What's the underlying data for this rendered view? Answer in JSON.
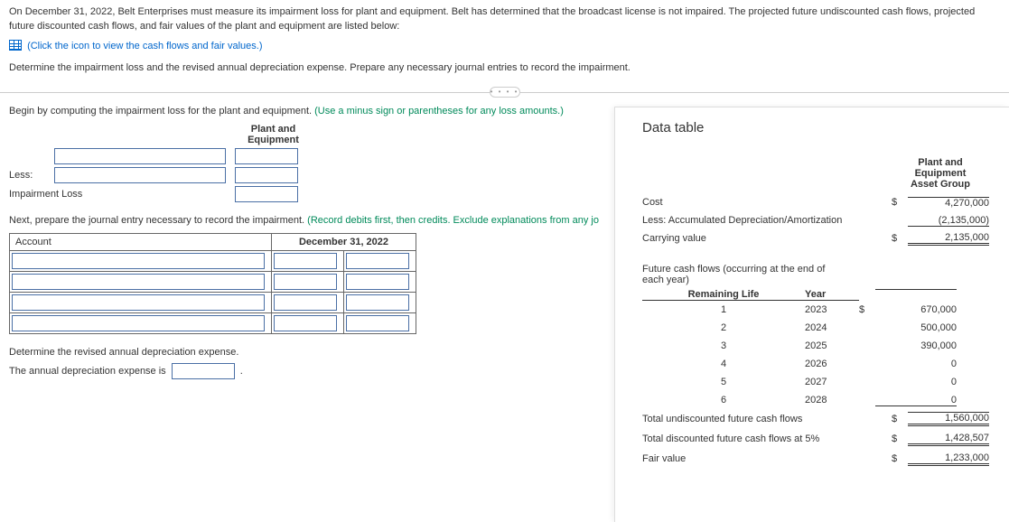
{
  "problem": {
    "p1": "On December 31, 2022, Belt Enterprises must measure its impairment loss for plant and equipment. Belt has determined that the broadcast license is not impaired. The projected future undiscounted cash flows, projected future discounted cash flows, and fair values of the plant and equipment are listed below:",
    "click_link": "(Click the icon to view the cash flows and fair values.)",
    "p2": "Determine the impairment loss and the revised annual depreciation expense. Prepare any necessary journal entries to record the impairment."
  },
  "sep_dots": "• • • •",
  "calc": {
    "instr_plain": "Begin by computing the impairment loss for the plant and equipment. ",
    "instr_green": "(Use a minus sign or parentheses for any loss amounts.)",
    "header1": "Plant and",
    "header2": "Equipment",
    "less_label": "Less:",
    "imp_label": "Impairment Loss"
  },
  "je": {
    "instr_plain": "Next, prepare the journal entry necessary to record the impairment. ",
    "instr_green": "(Record debits first, then credits. Exclude explanations from any jo",
    "col_account": "Account",
    "col_date": "December 31, 2022"
  },
  "dep": {
    "heading": "Determine the revised annual depreciation expense.",
    "line": "The annual depreciation expense is",
    "period": "."
  },
  "panel": {
    "title": "Data table",
    "group_h1": "Plant and Equipment",
    "group_h2": "Asset Group",
    "rows1": {
      "cost_l": "Cost",
      "cost_c": "$",
      "cost_v": "4,270,000",
      "ad_l": "Less: Accumulated Depreciation/Amortization",
      "ad_v": "(2,135,000)",
      "cv_l": "Carrying value",
      "cv_c": "$",
      "cv_v": "2,135,000"
    },
    "cf_intro1": "Future cash flows (occurring at the end of",
    "cf_intro2": "each year)",
    "cf_h1": "Remaining Life",
    "cf_h2": "Year",
    "cf": [
      {
        "life": "1",
        "year": "2023",
        "cur": "$",
        "amt": "670,000"
      },
      {
        "life": "2",
        "year": "2024",
        "cur": "",
        "amt": "500,000"
      },
      {
        "life": "3",
        "year": "2025",
        "cur": "",
        "amt": "390,000"
      },
      {
        "life": "4",
        "year": "2026",
        "cur": "",
        "amt": "0"
      },
      {
        "life": "5",
        "year": "2027",
        "cur": "",
        "amt": "0"
      },
      {
        "life": "6",
        "year": "2028",
        "cur": "",
        "amt": "0"
      }
    ],
    "tot1_l": "Total undiscounted future cash flows",
    "tot1_c": "$",
    "tot1_v": "1,560,000",
    "tot2_l": "Total discounted future cash flows at 5%",
    "tot2_c": "$",
    "tot2_v": "1,428,507",
    "tot3_l": "Fair value",
    "tot3_c": "$",
    "tot3_v": "1,233,000"
  }
}
